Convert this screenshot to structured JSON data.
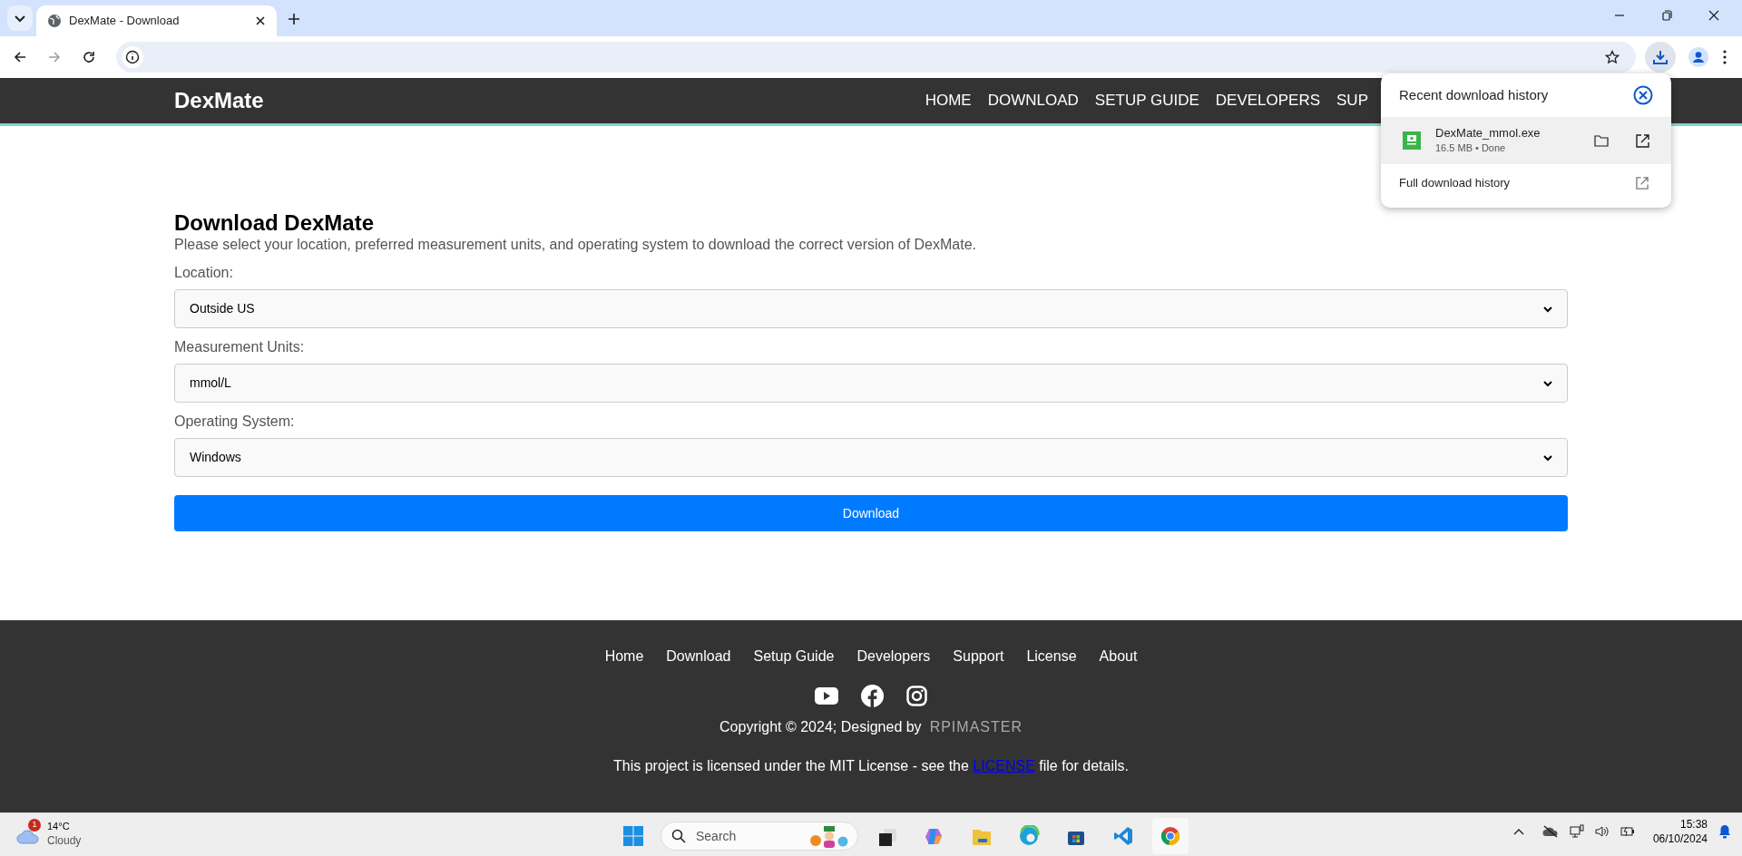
{
  "browser": {
    "tabs": [
      {
        "title": "DexMate - Download",
        "selected": true
      }
    ]
  },
  "site_nav": {
    "brand": "DexMate",
    "items": [
      "HOME",
      "DOWNLOAD",
      "SETUP GUIDE",
      "DEVELOPERS",
      "SUP"
    ]
  },
  "download_form": {
    "heading": "Download DexMate",
    "intro": "Please select your location, preferred measurement units, and operating system to download the correct version of DexMate.",
    "fields": [
      {
        "label": "Location:",
        "value": "Outside US"
      },
      {
        "label": "Measurement Units:",
        "value": "mmol/L"
      },
      {
        "label": "Operating System:",
        "value": "Windows"
      }
    ],
    "button": "Download"
  },
  "footer": {
    "links": [
      "Home",
      "Download",
      "Setup Guide",
      "Developers",
      "Support",
      "License",
      "About"
    ],
    "copyright": "Copyright © 2024; Designed by",
    "designer": "RPIMASTER",
    "license_before": "This project is licensed under the MIT License - see the",
    "license_link": "LICENSE",
    "license_after": "file for details."
  },
  "download_popup": {
    "title": "Recent download history",
    "items": [
      {
        "filename": "DexMate_mmol.exe",
        "meta": "16.5 MB • Done"
      }
    ],
    "full_history": "Full download history"
  },
  "taskbar": {
    "weather": {
      "badge": "1",
      "temperature": "14°C",
      "condition": "Cloudy"
    },
    "search": {
      "placeholder": "Search"
    },
    "time": "15:38",
    "date": "06/10/2024"
  }
}
